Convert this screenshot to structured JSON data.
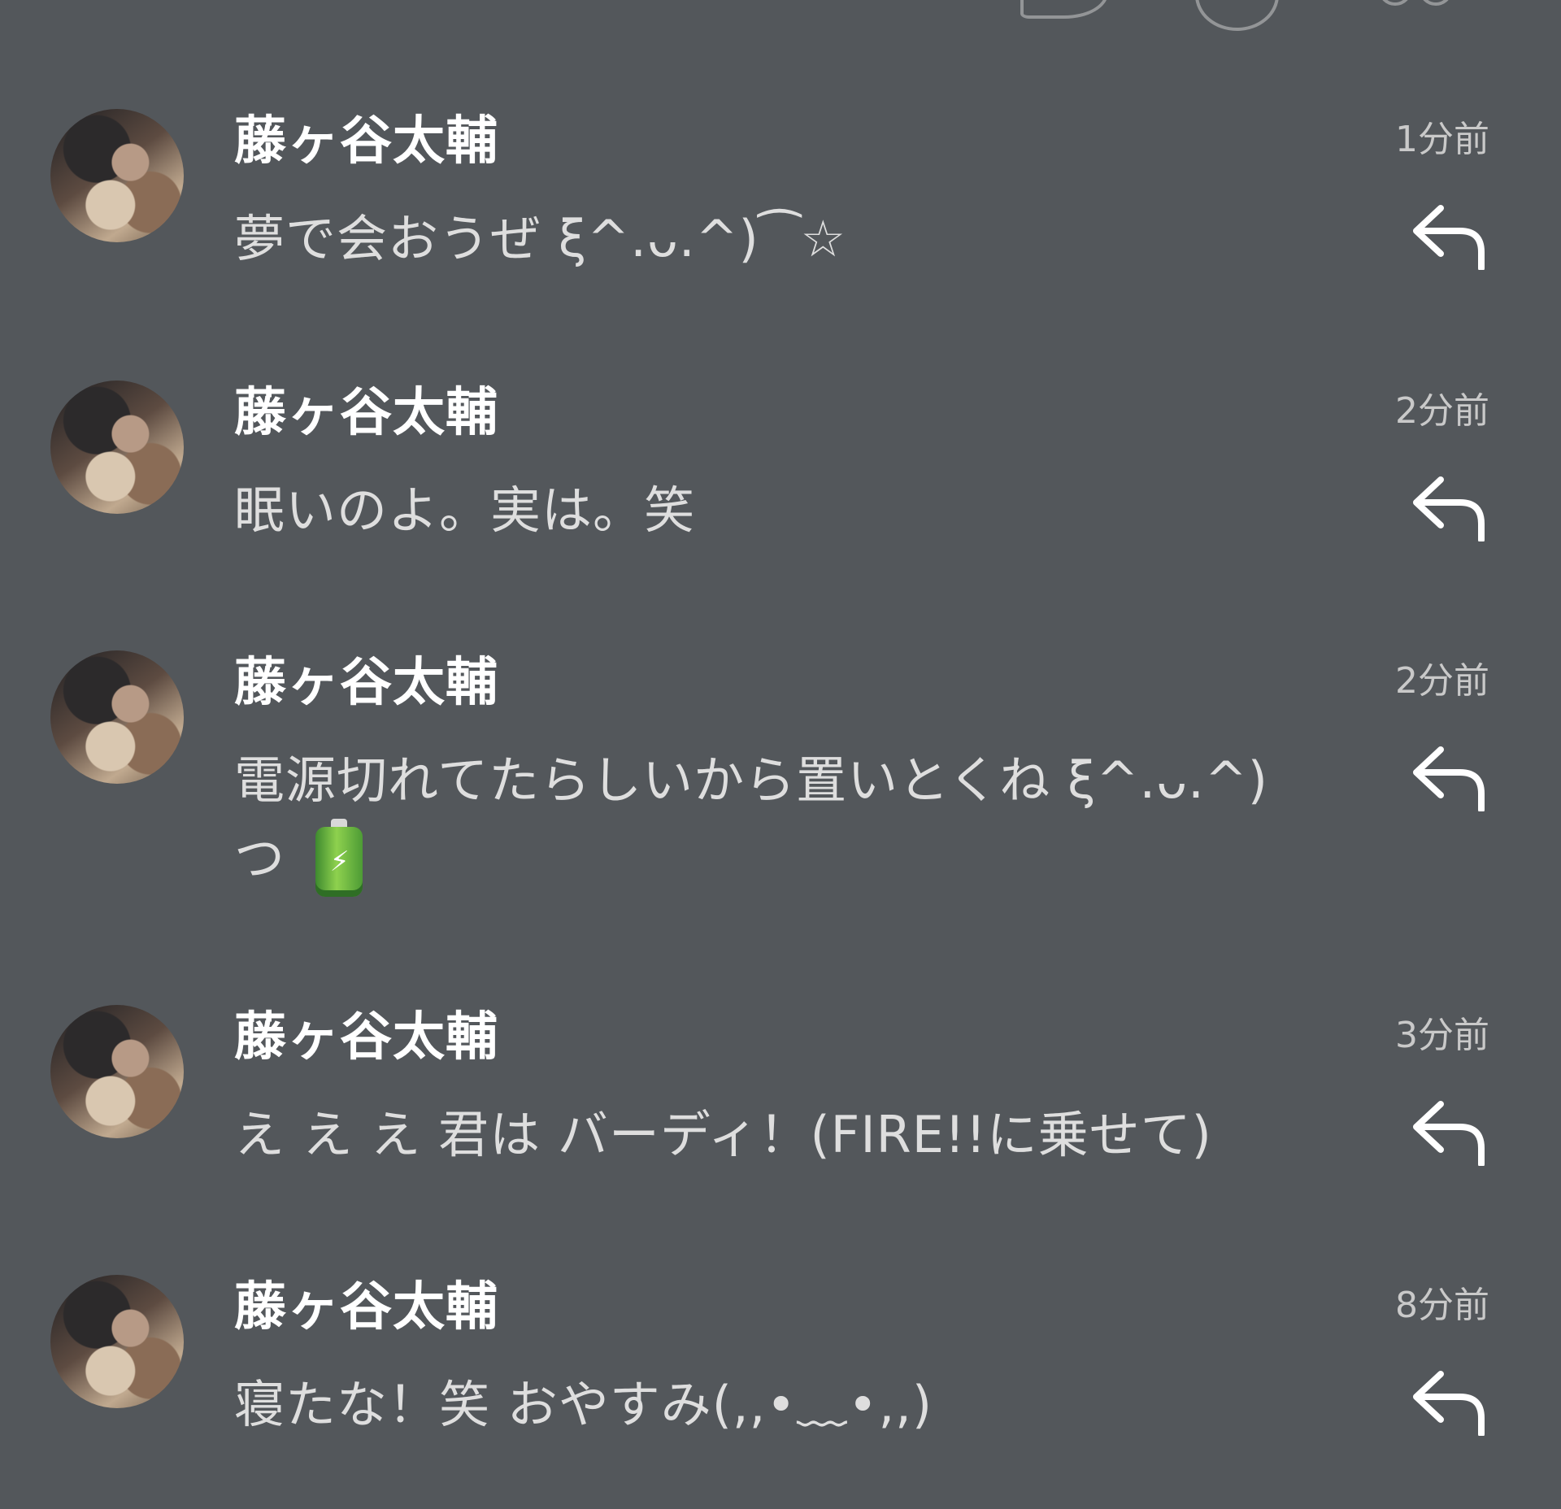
{
  "icons": {
    "top": [
      "chat-bubble-icon",
      "circle-icon",
      "dots-icon",
      "back-icon"
    ],
    "reply": "reply-arrow-icon",
    "battery": "battery-icon"
  },
  "notifications": [
    {
      "name": "藤ヶ谷太輔",
      "time": "1分前",
      "message": "夢で会おうぜ ξ^.ᴗ.^)⁀☆"
    },
    {
      "name": "藤ヶ谷太輔",
      "time": "2分前",
      "message": "眠いのよ。実は。笑"
    },
    {
      "name": "藤ヶ谷太輔",
      "time": "2分前",
      "message_line_1": "電源切れてたらしいから置いとくね ξ^.ᴗ.^)",
      "message_line_2": "つ"
    },
    {
      "name": "藤ヶ谷太輔",
      "time": "3分前",
      "message": "え え え 君は バーディ！(FIRE!!に乗せて)"
    },
    {
      "name": "藤ヶ谷太輔",
      "time": "8分前",
      "message": "寝たな！笑 おやすみ(,,•﹏•,,)"
    }
  ]
}
